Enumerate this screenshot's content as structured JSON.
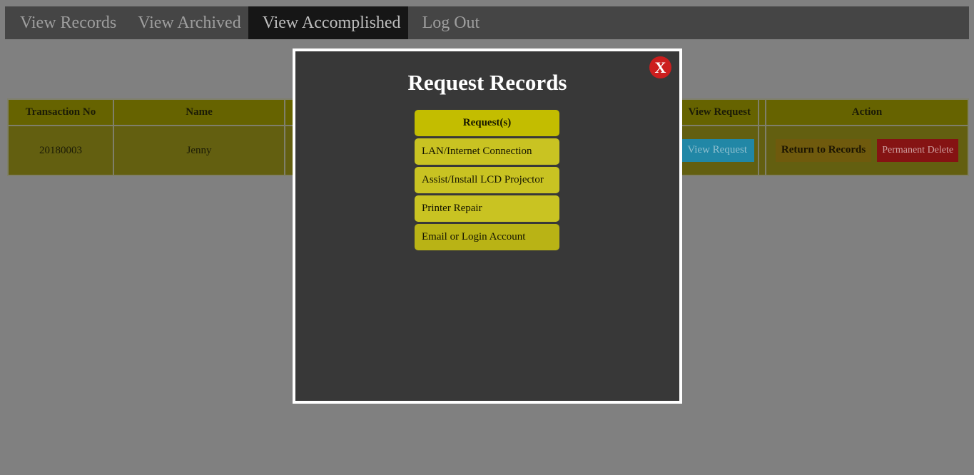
{
  "nav": {
    "items": [
      {
        "label": "View Records",
        "active": false
      },
      {
        "label": "View Archived",
        "active": false
      },
      {
        "label": "View Accomplished",
        "active": true
      },
      {
        "label": "Log Out",
        "active": false
      }
    ]
  },
  "table": {
    "headers": {
      "transaction_no": "Transaction No",
      "name": "Name",
      "view_request": "View Request",
      "action": "Action"
    },
    "rows": [
      {
        "transaction_no": "20180003",
        "name": "Jenny",
        "view_request_button": "View Request",
        "return_button": "Return to Records",
        "delete_button": "Permanent Delete"
      }
    ]
  },
  "modal": {
    "title": "Request Records",
    "close_label": "X",
    "list_header": "Request(s)",
    "requests": [
      "LAN/Internet Connection",
      "Assist/Install LCD Projector",
      "Printer Repair",
      "Email or Login Account"
    ]
  },
  "colors": {
    "overlay": "#808080",
    "nav_bg": "#454545",
    "nav_active_bg": "#161616",
    "table_header_bg": "#666300",
    "table_row_bg": "#635f10",
    "view_button": "#2187a6",
    "return_button": "#6f5a0d",
    "delete_button": "#851313",
    "modal_bg": "#383838",
    "close_button": "#cc1e1e",
    "request_item": "#c9c322"
  }
}
